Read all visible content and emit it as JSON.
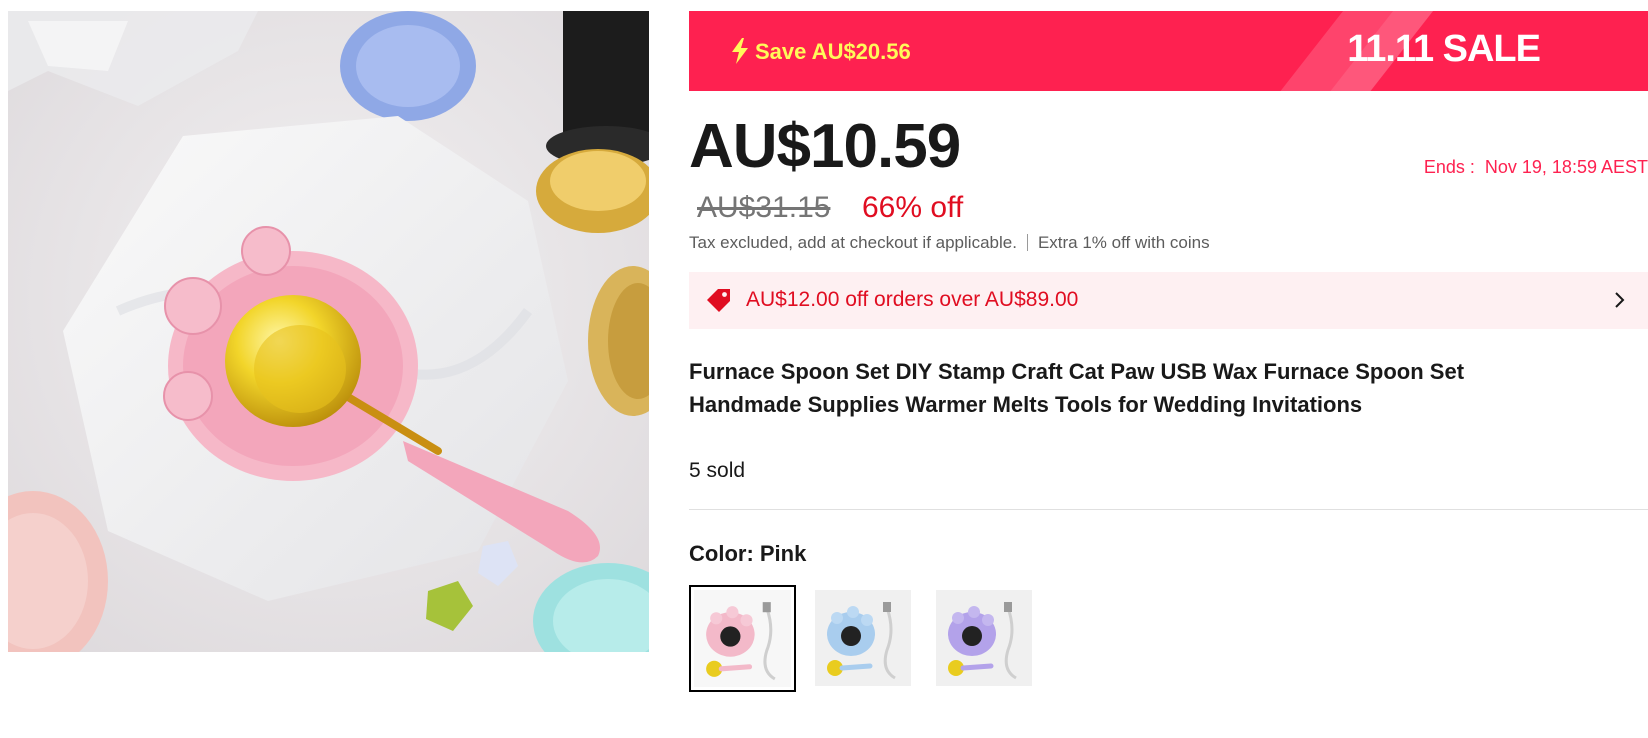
{
  "product_image": {
    "alt": "Pink cat paw wax furnace with gold spoon"
  },
  "banner": {
    "save_text": "Save AU$20.56",
    "sale_text": "11.11 SALE",
    "bg_color": "#fe2150",
    "save_color": "#fff95a"
  },
  "price": {
    "current": "AU$10.59",
    "original": "AU$31.15",
    "discount": "66% off",
    "ends_label": "Ends :",
    "ends_time": "Nov 19, 18:59 AEST"
  },
  "tax": {
    "note": "Tax excluded, add at checkout if applicable.",
    "coins": "Extra 1% off with coins"
  },
  "coupon": {
    "text": "AU$12.00 off orders over AU$89.00",
    "icon": "tag-icon",
    "action_icon": "chevron-right-icon"
  },
  "product": {
    "title": "Furnace Spoon Set DIY Stamp Craft Cat Paw USB Wax Furnace Spoon Set Handmade Supplies Warmer Melts Tools for Wedding Invitations",
    "sold": "5 sold"
  },
  "variants": {
    "label": "Color: Pink",
    "options": [
      {
        "name": "Pink",
        "selected": true,
        "color": "#f3b9c9"
      },
      {
        "name": "Blue",
        "selected": false,
        "color": "#a9cdee"
      },
      {
        "name": "Purple",
        "selected": false,
        "color": "#b3a2ea"
      }
    ]
  }
}
